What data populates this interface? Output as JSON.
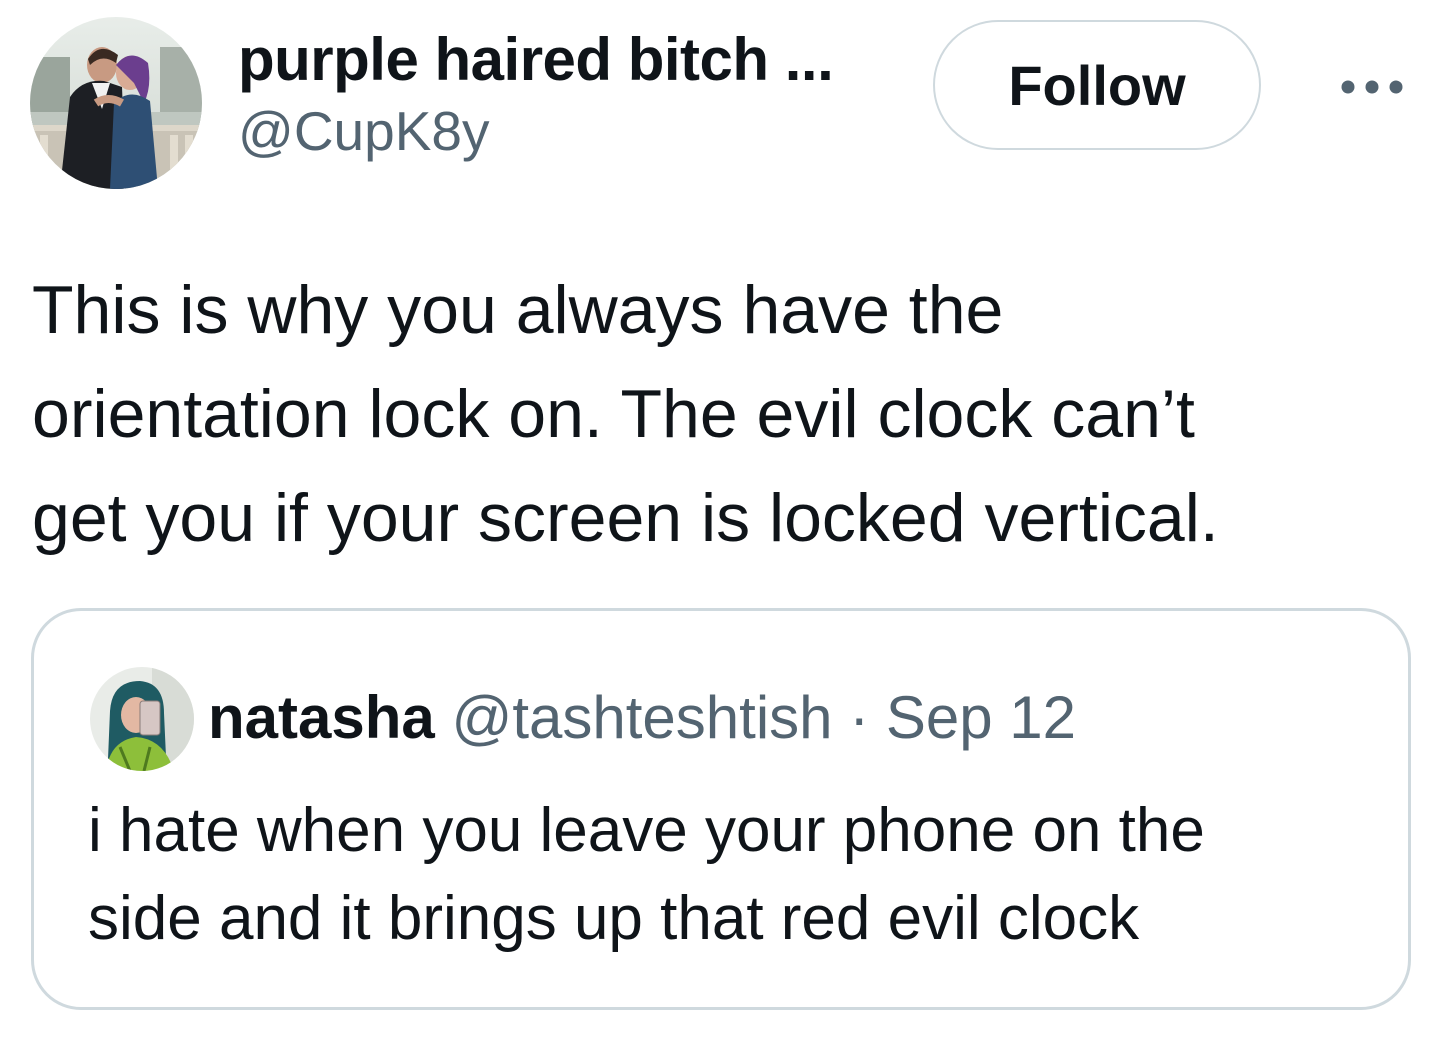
{
  "author": {
    "display_name": "purple haired bitch ...",
    "handle": "@CupK8y",
    "avatar_icon": "profile-photo-couple"
  },
  "actions": {
    "follow_label": "Follow",
    "more_icon": "more-horizontal-icon"
  },
  "tweet": {
    "lines": [
      "This is why you always have the",
      "orientation lock on. The evil clock can’t",
      "get you if your screen is locked vertical."
    ]
  },
  "quote": {
    "display_name": "natasha",
    "handle": "@tashteshtish",
    "separator": "·",
    "date": "Sep 12",
    "avatar_icon": "profile-photo-selfie",
    "lines": [
      "i hate when you leave your phone on the",
      "side and it brings up that red evil clock"
    ]
  },
  "colors": {
    "text_primary": "#0f1419",
    "text_secondary": "#536471",
    "border": "#cfd9de",
    "background": "#ffffff"
  }
}
